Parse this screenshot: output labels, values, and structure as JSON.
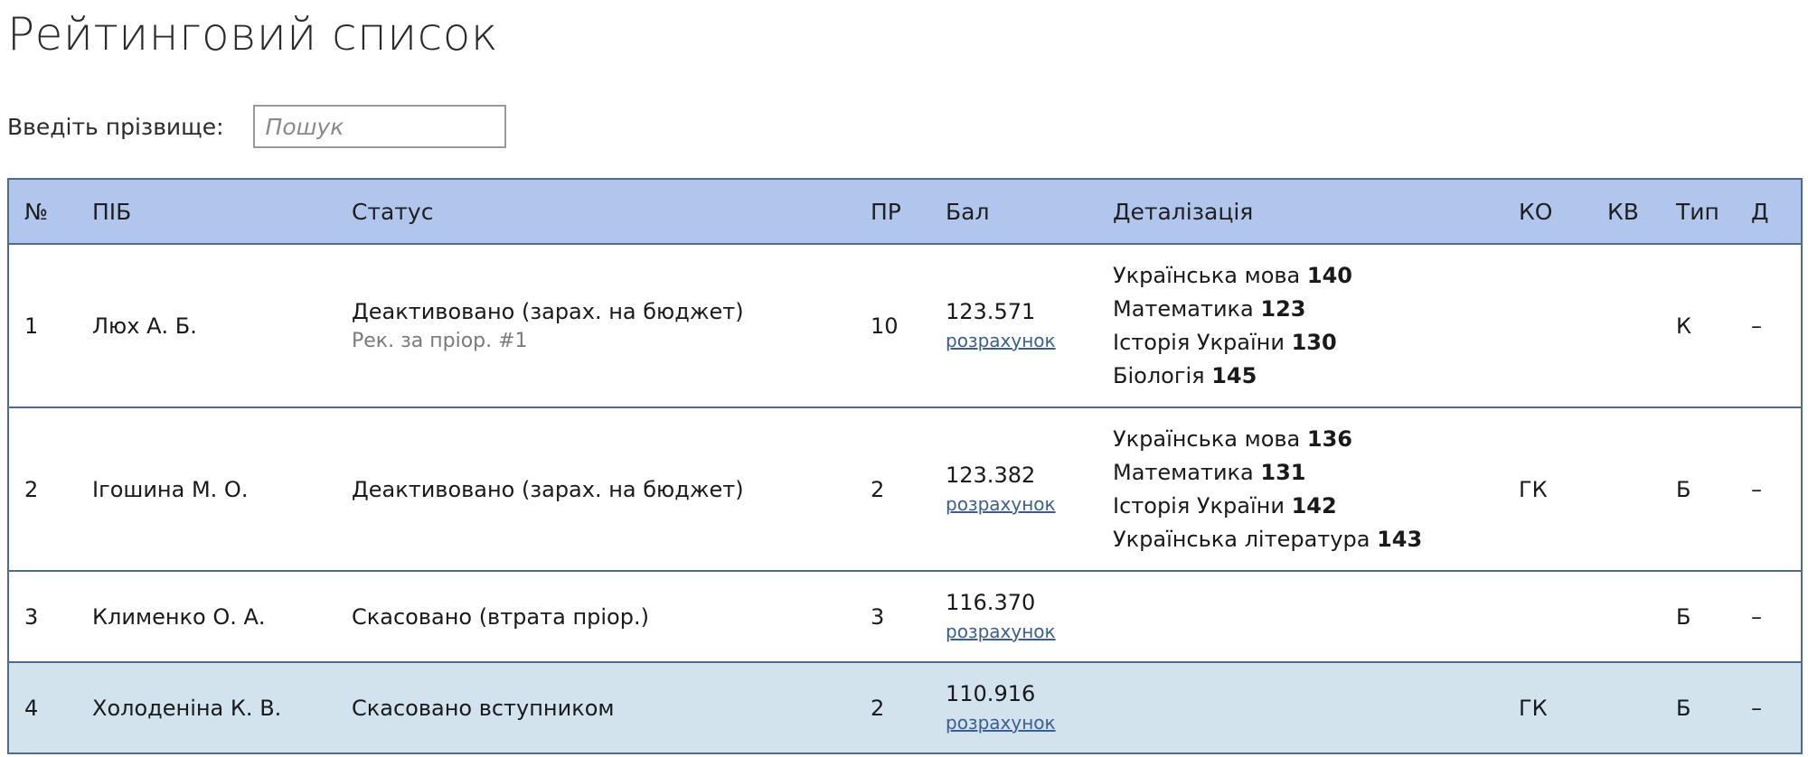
{
  "page": {
    "title": "Рейтинговий список"
  },
  "search": {
    "label": "Введіть прізвище:",
    "placeholder": "Пошук",
    "value": ""
  },
  "table": {
    "headers": {
      "num": "№",
      "name": "ПІБ",
      "status": "Статус",
      "priority": "ПР",
      "score": "Бал",
      "details": "Деталізація",
      "ko": "КО",
      "kv": "КВ",
      "type": "Тип",
      "d": "Д"
    },
    "rows": [
      {
        "num": "1",
        "name": "Люх А. Б.",
        "status": "Деактивовано (зарах. на бюджет)",
        "status_note": "Рек. за пріор. #1",
        "priority": "10",
        "score": "123.571",
        "calc_link": "розрахунок",
        "details": [
          {
            "subject": "Українська мова",
            "score": "140"
          },
          {
            "subject": "Математика",
            "score": "123"
          },
          {
            "subject": "Історія України",
            "score": "130"
          },
          {
            "subject": "Біологія",
            "score": "145"
          }
        ],
        "ko": "",
        "kv": "",
        "type": "К",
        "d": "–"
      },
      {
        "num": "2",
        "name": "Ігошина М. О.",
        "status": "Деактивовано (зарах. на бюджет)",
        "status_note": "",
        "priority": "2",
        "score": "123.382",
        "calc_link": "розрахунок",
        "details": [
          {
            "subject": "Українська мова",
            "score": "136"
          },
          {
            "subject": "Математика",
            "score": "131"
          },
          {
            "subject": "Історія України",
            "score": "142"
          },
          {
            "subject": "Українська література",
            "score": "143"
          }
        ],
        "ko": "ГК",
        "kv": "",
        "type": "Б",
        "d": "–"
      },
      {
        "num": "3",
        "name": "Клименко О. А.",
        "status": "Скасовано (втрата пріор.)",
        "status_note": "",
        "priority": "3",
        "score": "116.370",
        "calc_link": "розрахунок",
        "details": [],
        "ko": "",
        "kv": "",
        "type": "Б",
        "d": "–"
      },
      {
        "num": "4",
        "name": "Холоденіна К. В.",
        "status": "Скасовано вступником",
        "status_note": "",
        "priority": "2",
        "score": "110.916",
        "calc_link": "розрахунок",
        "details": [],
        "ko": "ГК",
        "kv": "",
        "type": "Б",
        "d": "–"
      }
    ]
  },
  "colors": {
    "header_bg": "#b0c6ec",
    "highlight_row_bg": "#d2e3ee",
    "border": "#506a8e",
    "link": "#3a5f8f"
  }
}
